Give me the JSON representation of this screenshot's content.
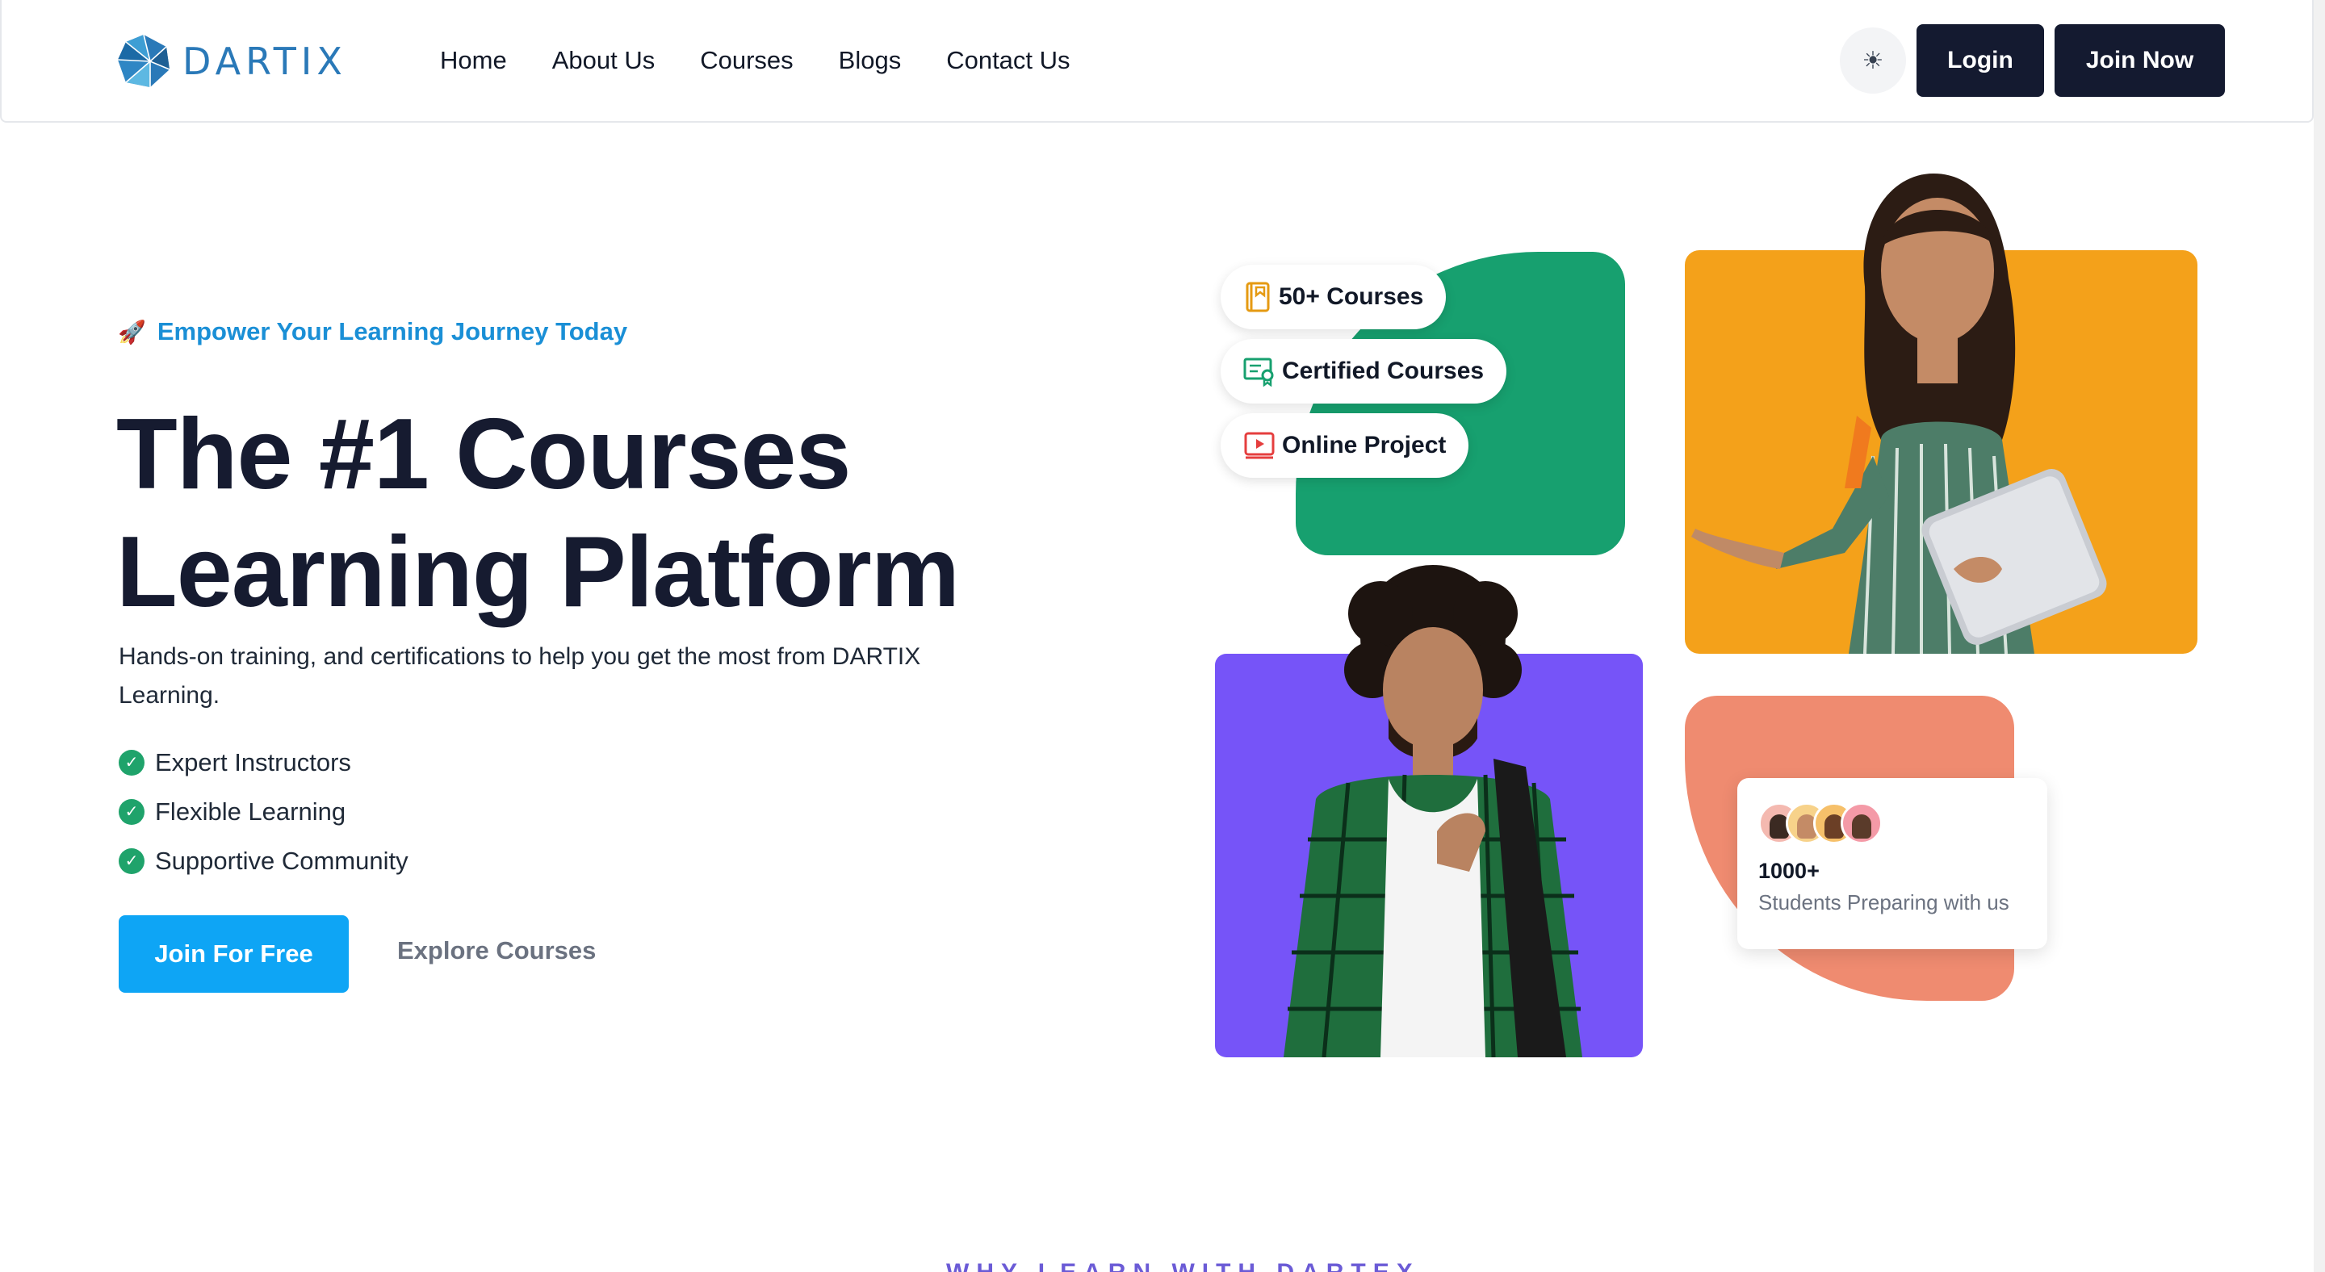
{
  "brand": {
    "name": "DARTIX"
  },
  "nav": {
    "items": [
      {
        "label": "Home"
      },
      {
        "label": "About Us"
      },
      {
        "label": "Courses"
      },
      {
        "label": "Blogs"
      },
      {
        "label": "Contact Us"
      }
    ]
  },
  "header_actions": {
    "theme_icon": "sun-icon",
    "login_label": "Login",
    "join_label": "Join Now"
  },
  "hero": {
    "tagline_icon": "rocket-icon",
    "tagline": "Empower Your Learning Journey Today",
    "title_line1": "The #1 Courses",
    "title_line2": "Learning Platform",
    "description": "Hands-on training, and certifications to help you get the most from DARTIX Learning.",
    "features": [
      {
        "label": "Expert Instructors"
      },
      {
        "label": "Flexible Learning"
      },
      {
        "label": "Supportive Community"
      }
    ],
    "primary_cta": "Join For Free",
    "secondary_cta": "Explore Courses"
  },
  "collage": {
    "badges": [
      {
        "label": "50+ Courses",
        "icon": "book-icon"
      },
      {
        "label": "Certified Courses",
        "icon": "certificate-icon"
      },
      {
        "label": "Online Project",
        "icon": "video-icon"
      }
    ],
    "students": {
      "count": "1000+",
      "label": "Students Preparing with us"
    },
    "colors": {
      "green": "#17a06f",
      "orange": "#f4a11a",
      "purple": "#7654f8",
      "coral": "#ef8b70"
    }
  },
  "next_section": {
    "eyebrow": "WHY LEARN WITH DARTEX"
  },
  "theme": {
    "primary": "#0ea5f5",
    "dark": "#141a30",
    "accent_text": "#1a8fd6"
  }
}
